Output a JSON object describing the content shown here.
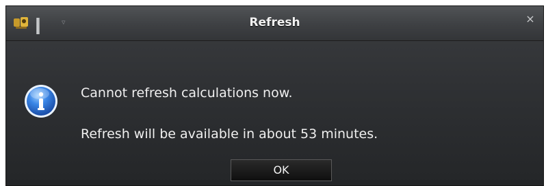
{
  "window": {
    "title": "Refresh",
    "close_glyph": "×",
    "app_icon": "app-logo-icon",
    "quick_access_glyph": "▿"
  },
  "dialog": {
    "icon": "info-icon",
    "message_line_1": "Cannot refresh calculations now.",
    "message_line_2": "Refresh will be available in about 53 minutes.",
    "ok_label": "OK"
  },
  "colors": {
    "window_bg": "#2f3134",
    "titlebar_bg": "#3e4043",
    "text": "#f0f0f0",
    "info_blue": "#2f6fd1",
    "button_bg": "#151515"
  }
}
